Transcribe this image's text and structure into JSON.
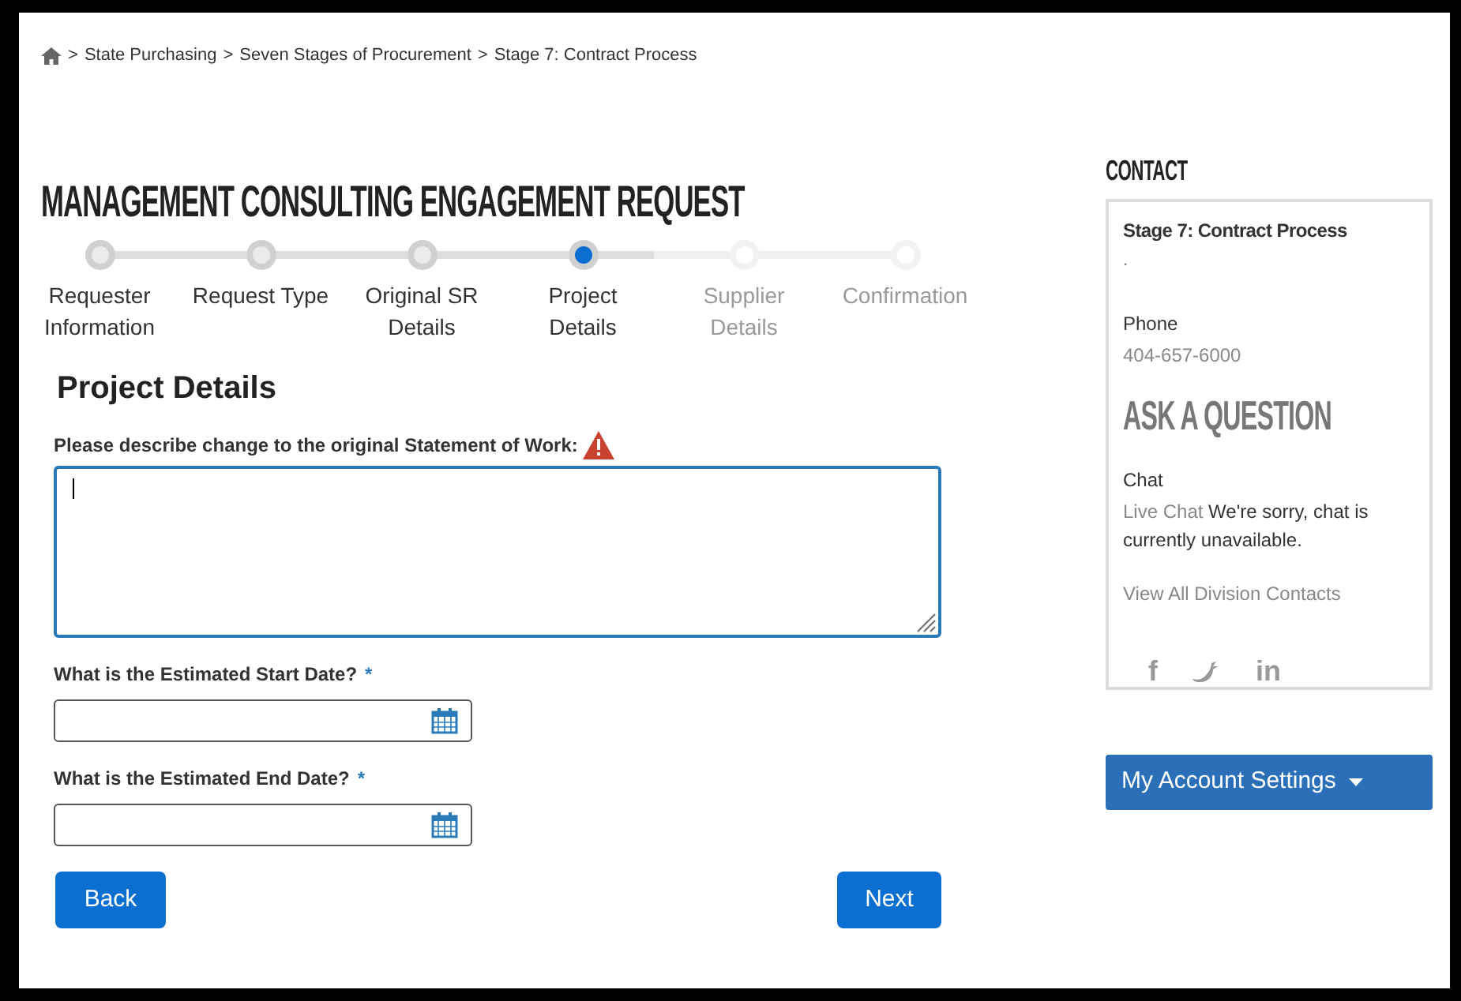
{
  "breadcrumb": [
    "State Purchasing",
    "Seven Stages of Procurement",
    "Stage 7: Contract Process"
  ],
  "breadcrumb_separator": ">",
  "title": "MANAGEMENT CONSULTING ENGAGEMENT REQUEST",
  "steps": [
    {
      "label": "Requester Information",
      "completed": true,
      "selected": false
    },
    {
      "label": "Request Type",
      "completed": true,
      "selected": false
    },
    {
      "label": "Original SR Details",
      "completed": true,
      "selected": false
    },
    {
      "label": "Project Details",
      "completed": false,
      "selected": true
    },
    {
      "label": "Supplier Details",
      "completed": false,
      "selected": false
    },
    {
      "label": "Confirmation",
      "completed": false,
      "selected": false
    }
  ],
  "section_title": "Project Details",
  "fields": [
    {
      "kind": "textarea",
      "label": "Please describe change to the original Statement of Work:",
      "warning": true,
      "required": false,
      "focused": true
    },
    {
      "kind": "date",
      "label": "What is the Estimated Start Date?",
      "warning": false,
      "required": true,
      "focused": false
    },
    {
      "kind": "date",
      "label": "What is the Estimated End Date?",
      "warning": false,
      "required": true,
      "focused": false
    }
  ],
  "required_mark": "*",
  "buttons": [
    "Back",
    "Next"
  ],
  "sidebar": {
    "contact_heading": "CONTACT",
    "contact_name": "Stage 7: Contract Process",
    "contact_dot": ".",
    "phone_label": "Phone",
    "phone": "404-657-6000",
    "ask_heading": "ASK A QUESTION",
    "chat_label": "Chat",
    "chat_link": "Live Chat",
    "chat_status": "We're sorry, chat is currently unavailable.",
    "division_link": "View All Division Contacts",
    "social": [
      {
        "kind": "facebook",
        "text": "f"
      },
      {
        "kind": "twitter"
      },
      {
        "kind": "linkedin",
        "text": "in"
      }
    ],
    "account_button": "My Account Settings"
  }
}
